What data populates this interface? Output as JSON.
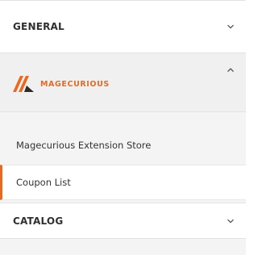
{
  "general": {
    "title": "GENERAL",
    "state": "collapsed",
    "chevron": "chevron-down-icon"
  },
  "brand": {
    "name_part1": "MAGE",
    "name_part2": "CURIOUS",
    "state": "expanded",
    "chevron": "chevron-up-icon",
    "logo_color": "#e86a1f"
  },
  "items": [
    {
      "label": "Magecurious Extension Store",
      "active": false
    },
    {
      "label": "Coupon List",
      "active": true
    }
  ],
  "catalog": {
    "title": "CATALOG",
    "state": "collapsed",
    "chevron": "chevron-down-icon"
  },
  "colors": {
    "accent": "#e86a1f",
    "panel_bg": "#f4f4f4",
    "header_bg": "#ffffff"
  }
}
